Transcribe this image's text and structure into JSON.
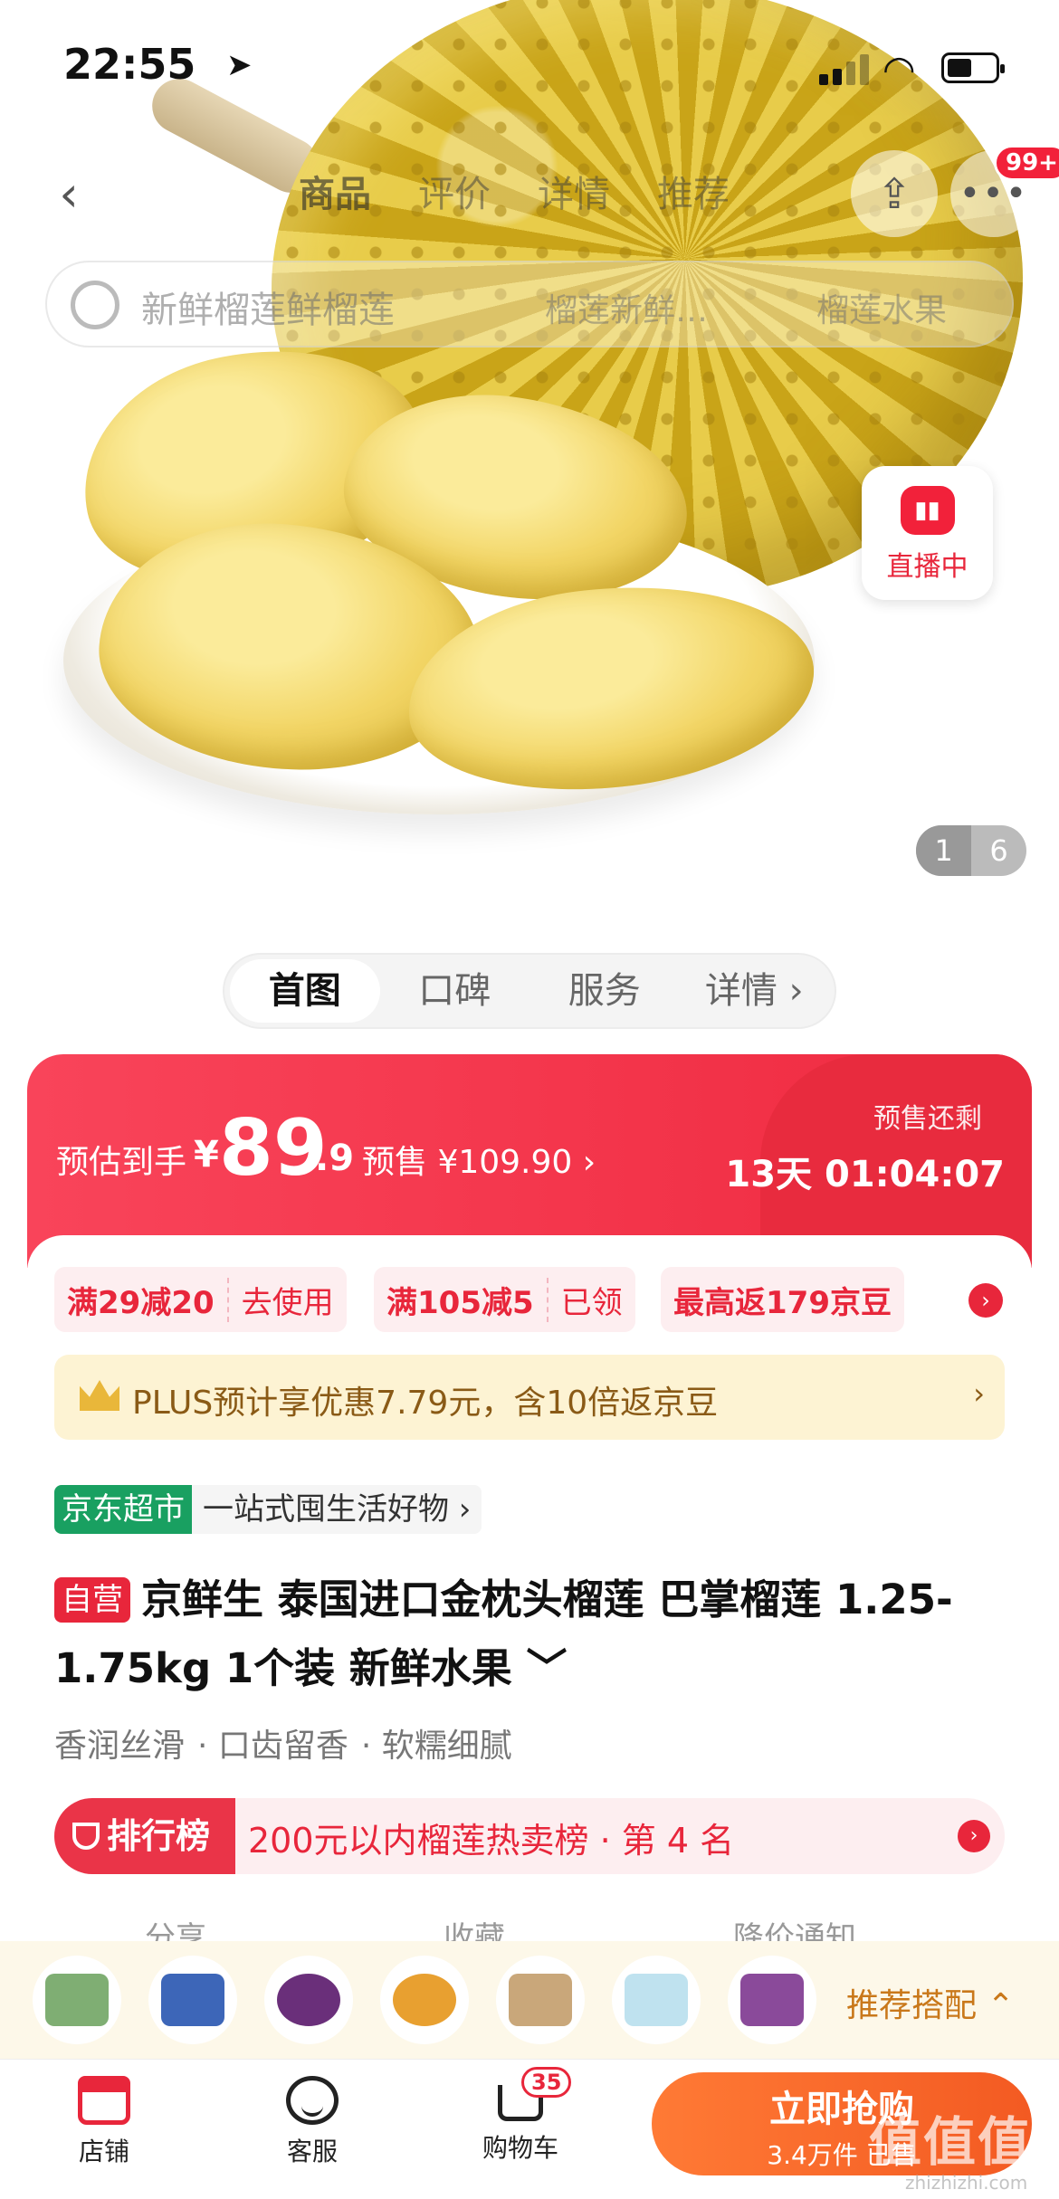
{
  "status": {
    "time": "22:55"
  },
  "nav": {
    "tabs": [
      "商品",
      "评价",
      "详情",
      "推荐"
    ],
    "badge": "99+"
  },
  "search": {
    "placeholder": "新鲜榴莲鲜榴莲",
    "chips": [
      "榴莲新鲜…",
      "榴莲水果"
    ]
  },
  "live": {
    "label": "直播中"
  },
  "pager": {
    "current": "1",
    "total": "6"
  },
  "segments": [
    "首图",
    "口碑",
    "服务",
    "详情 ›"
  ],
  "price": {
    "label": "预估到手",
    "currency": "¥",
    "integer": "89",
    "decimal": ".9",
    "presale": "预售 ¥109.90 ›",
    "remaining_label": "预售还剩",
    "countdown": "13天 01:04:07"
  },
  "coupons": [
    {
      "title": "满29减20",
      "action": "去使用"
    },
    {
      "title": "满105减5",
      "action": "已领"
    },
    {
      "title": "最高返179京豆",
      "action": ""
    }
  ],
  "plus": {
    "text": "PLUS预计享优惠7.79元，含10倍返京豆",
    "arrow": "›"
  },
  "store_tag": {
    "name": "京东超市",
    "slogan": "一站式囤生活好物 ›"
  },
  "product": {
    "self_label": "自营",
    "title": "京鲜生 泰国进口金枕头榴莲 巴掌榴莲 1.25-1.75kg 1个装 新鲜水果 ﹀",
    "tags": [
      "香润丝滑",
      "· 口齿留香",
      "· 软糯细腻"
    ]
  },
  "rank": {
    "label": "排行榜",
    "text": "200元以内榴莲热卖榜 · 第 4 名"
  },
  "actions": [
    "分享",
    "收藏",
    "降价通知"
  ],
  "recommend": {
    "label": "推荐搭配 ⌃"
  },
  "bottom": {
    "store": "店铺",
    "service": "客服",
    "cart": "购物车",
    "cart_count": "35",
    "buy_label": "立即抢购",
    "buy_sub": "3.4万件 已售"
  },
  "watermark": {
    "text": "值值值",
    "site": "zhizhizhi.com"
  },
  "colors": {
    "accent": "#e8263b",
    "buy": "#f35a22",
    "plus_bg": "#fdf3d3"
  }
}
